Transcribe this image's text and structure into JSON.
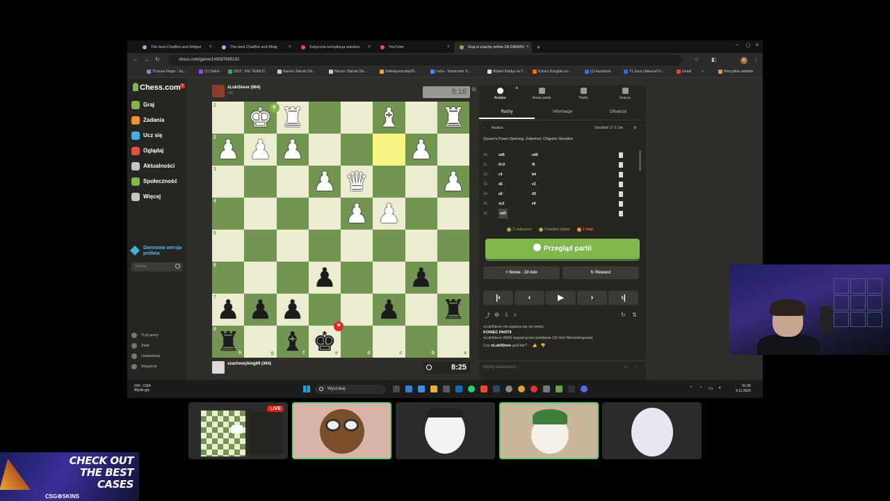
{
  "browser": {
    "tabs": [
      {
        "title": "The best ChatBot and Widget",
        "color": "#8ab4f8",
        "active": false
      },
      {
        "title": "The best ChatBot and Widg",
        "color": "#8ab4f8",
        "active": false
      },
      {
        "title": "Sokyczna kompilacja autobus",
        "color": "#ff4e45",
        "active": false
      },
      {
        "title": "YouTube",
        "color": "#ff4e45",
        "active": false
      },
      {
        "title": "Graj w szachy online ZA DARMO",
        "color": "#81b64c",
        "active": true
      }
    ],
    "new_tab": "+",
    "url": "chess.com/game/145087695192",
    "avatar_letter": "K",
    "bookmarks": [
      {
        "label": "Thomas Finger - Su...",
        "color": "#6c8ebf"
      },
      {
        "label": "(1) Twitch",
        "color": "#9146ff"
      },
      {
        "label": "2022 - IHG TEAM D...",
        "color": "#34a853"
      },
      {
        "label": "Naruto i Naruto Shi...",
        "color": "#cccccc"
      },
      {
        "label": "Naruto i Naruto Shi...",
        "color": "#cccccc"
      },
      {
        "label": "Defeatyesterday29...",
        "color": "#e8a33d"
      },
      {
        "label": "LeGs - Summoner S...",
        "color": "#4285f4"
      },
      {
        "label": "Wojtek Kardys na T...",
        "color": "#dddddd"
      },
      {
        "label": "Kuba's thoughts on...",
        "color": "#ff6d00"
      },
      {
        "label": "(1) Facebook",
        "color": "#1877f2"
      },
      {
        "label": "T1 Zeus | AfreecaTV...",
        "color": "#2d6cdf"
      },
      {
        "label": "Gmail",
        "color": "#ea4335"
      }
    ],
    "bookmarks_more": "»",
    "all_bookmarks": "Wszystkie zakładki"
  },
  "sidebar": {
    "logo": "Chess.com",
    "logo_badge": "1",
    "items": [
      {
        "label": "Graj",
        "color": "#81b64c"
      },
      {
        "label": "Zadania",
        "color": "#f7902c"
      },
      {
        "label": "Ucz się",
        "color": "#3fb1e6"
      },
      {
        "label": "Oglądaj",
        "color": "#e4503c"
      },
      {
        "label": "Aktualności",
        "color": "#c5c4c1"
      },
      {
        "label": "Społeczność",
        "color": "#81b64c"
      },
      {
        "label": "Więcej",
        "color": "#c5c4c1"
      }
    ],
    "demo": "Darmowa wersja próbna",
    "search_placeholder": "Szukaj",
    "bottom": [
      {
        "label": "Tryb jasny"
      },
      {
        "label": "Zwiń"
      },
      {
        "label": "Ustawienia"
      },
      {
        "label": "Wsparcie"
      }
    ]
  },
  "game": {
    "top_player": {
      "name": "xLukiSteve (684)",
      "sub": "+11"
    },
    "top_clock": "8:16",
    "bottom_player": {
      "name": "szachowyking69 (364)"
    },
    "bottom_clock": "8:25",
    "ranks": [
      "1",
      "2",
      "3",
      "4",
      "5",
      "6",
      "7",
      "8"
    ],
    "files": [
      "h",
      "g",
      "f",
      "e",
      "d",
      "c",
      "b",
      "a"
    ],
    "pieces": [
      {
        "c": 1,
        "r": 0,
        "sym": "♚",
        "color": "w"
      },
      {
        "c": 2,
        "r": 0,
        "sym": "♜",
        "color": "w"
      },
      {
        "c": 5,
        "r": 0,
        "sym": "♝",
        "color": "w"
      },
      {
        "c": 7,
        "r": 0,
        "sym": "♜",
        "color": "w"
      },
      {
        "c": 0,
        "r": 1,
        "sym": "♟",
        "color": "w"
      },
      {
        "c": 1,
        "r": 1,
        "sym": "♟",
        "color": "w"
      },
      {
        "c": 2,
        "r": 1,
        "sym": "♟",
        "color": "w"
      },
      {
        "c": 6,
        "r": 1,
        "sym": "♟",
        "color": "w"
      },
      {
        "c": 3,
        "r": 2,
        "sym": "♟",
        "color": "w"
      },
      {
        "c": 4,
        "r": 2,
        "sym": "♛",
        "color": "w"
      },
      {
        "c": 7,
        "r": 2,
        "sym": "♟",
        "color": "w"
      },
      {
        "c": 4,
        "r": 3,
        "sym": "♟",
        "color": "w"
      },
      {
        "c": 5,
        "r": 3,
        "sym": "♟",
        "color": "w"
      },
      {
        "c": 3,
        "r": 5,
        "sym": "♟",
        "color": "b"
      },
      {
        "c": 6,
        "r": 5,
        "sym": "♟",
        "color": "b"
      },
      {
        "c": 0,
        "r": 6,
        "sym": "♟",
        "color": "b"
      },
      {
        "c": 1,
        "r": 6,
        "sym": "♟",
        "color": "b"
      },
      {
        "c": 2,
        "r": 6,
        "sym": "♟",
        "color": "b"
      },
      {
        "c": 5,
        "r": 6,
        "sym": "♟",
        "color": "b"
      },
      {
        "c": 7,
        "r": 6,
        "sym": "♜",
        "color": "b"
      },
      {
        "c": 0,
        "r": 7,
        "sym": "♜",
        "color": "b"
      },
      {
        "c": 2,
        "r": 7,
        "sym": "♝",
        "color": "b"
      },
      {
        "c": 3,
        "r": 7,
        "sym": "♚",
        "color": "b"
      }
    ],
    "highlight": {
      "c": 5,
      "r": 1
    },
    "winner_badge": {
      "c": 1,
      "r": 0,
      "color": "#81b64c"
    },
    "loser_badge": {
      "c": 3,
      "r": 7,
      "color": "#e02828"
    }
  },
  "panel": {
    "tabs": [
      "Analiza",
      "Nowa partia",
      "Partie",
      "Gracze"
    ],
    "close": "×",
    "subtabs": [
      "Ruchy",
      "Informacje",
      "Otwarcia"
    ],
    "analysis_label": "Analiza",
    "engine": "Stockfish 17.1 Lite",
    "opening": "Queen's Pawn Opening: Zukertort, Chigorin Variation",
    "moves": [
      {
        "n": "10.",
        "w": "xd5",
        "b": "xd5"
      },
      {
        "n": "11.",
        "w": "O-O",
        "b": "f5"
      },
      {
        "n": "12.",
        "w": "c4",
        "b": "b4"
      },
      {
        "n": "13.",
        "w": "d2",
        "b": "c2"
      },
      {
        "n": "14.",
        "w": "a3",
        "b": "d3"
      },
      {
        "n": "15.",
        "w": "xc2",
        "b": "e6"
      },
      {
        "n": "16.",
        "w": "xd3",
        "b": ""
      }
    ],
    "summary": [
      {
        "label": "3 najlepsze",
        "color": "#81b64c"
      },
      {
        "label": "3 bardzo dobre",
        "color": "#96bc4b"
      },
      {
        "label": "1 błąd",
        "color": "#f7902c"
      }
    ],
    "review_button": "Przegląd partii",
    "new_button": "Nowa - 10 min",
    "rematch_button": "Rewanż",
    "chat": {
      "line1": "xLukiSteve nie zgadza się na remis.",
      "end_title": "KONIEC PARTII",
      "end_text": "xLukiSteve (684) wygrał przez poddanie (10 min Nierankingowa)",
      "question_prefix": "Czy ",
      "question_name": "xLukiSteve",
      "question_suffix": " grał fair?",
      "input_placeholder": "Wyślij wiadomość..."
    }
  },
  "taskbar": {
    "weather_line1": "OVI - OSA",
    "weather_line2": "Wynik gry",
    "search": "Wyszukaj",
    "time": "01:35",
    "date": "4.11.2025"
  },
  "stream": {
    "live": "LIVE"
  },
  "ad": {
    "line1": "CHECK OUT",
    "line2": "THE BEST",
    "line3": "CASES",
    "brand": "CSG⚙SKINS"
  }
}
